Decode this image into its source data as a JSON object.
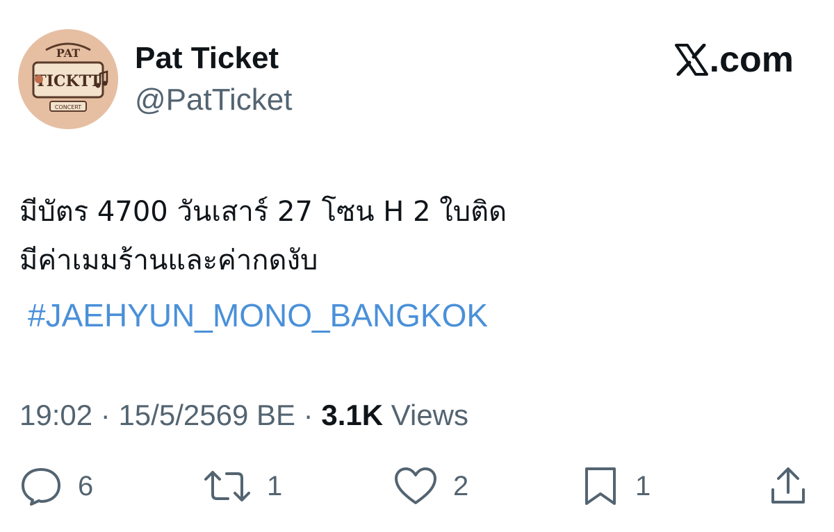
{
  "author": {
    "name": "Pat Ticket",
    "handle": "@PatTicket",
    "avatar_text": [
      "PAT",
      "TICKTT",
      "CONCERT"
    ]
  },
  "brand": {
    "site": ".com",
    "icon": "x-logo-icon"
  },
  "tweet": {
    "lines": [
      "มีบัตร 4700 วันเสาร์ 27 โซน H 2 ใบติด",
      "มีค่าเมมร้านและค่ากดงับ"
    ],
    "hashtag": "#JAEHYUN_MONO_BANGKOK"
  },
  "meta": {
    "time": "19:02",
    "separator": "·",
    "date": "15/5/2569 BE",
    "views_count": "3.1K",
    "views_label": "Views"
  },
  "actions": {
    "reply": {
      "icon": "reply-icon",
      "count": "6"
    },
    "retweet": {
      "icon": "retweet-icon",
      "count": "1"
    },
    "like": {
      "icon": "heart-icon",
      "count": "2"
    },
    "bookmark": {
      "icon": "bookmark-icon",
      "count": "1"
    },
    "share": {
      "icon": "share-icon"
    }
  },
  "colors": {
    "text": "#0f1419",
    "secondary": "#536471",
    "hashtag": "#4a90d9",
    "avatar_bg": "#e6bfa3"
  }
}
